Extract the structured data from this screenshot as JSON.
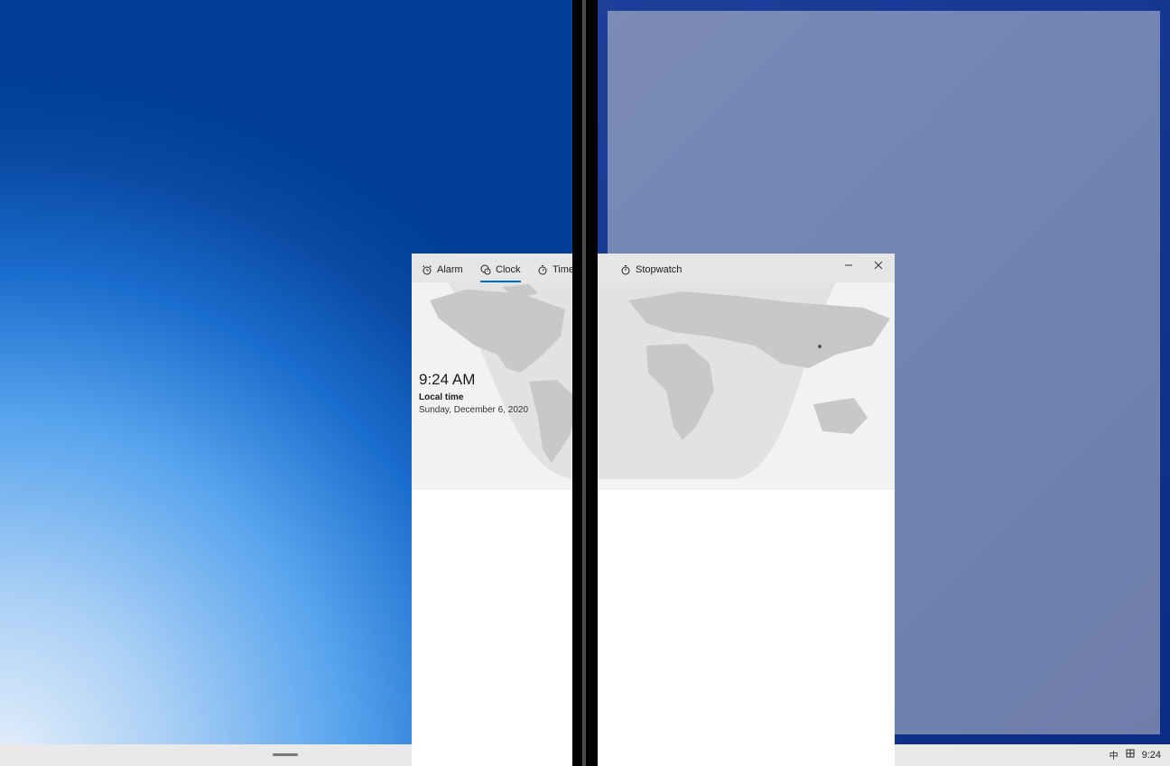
{
  "clock_app": {
    "tabs": [
      {
        "label": "Alarm",
        "icon": "alarm-clock-icon"
      },
      {
        "label": "Clock",
        "icon": "world-clock-icon",
        "active": true
      },
      {
        "label": "Timer",
        "icon": "timer-icon"
      },
      {
        "label": "Stopwatch",
        "icon": "stopwatch-icon"
      }
    ],
    "time": "9:24 AM",
    "location_label": "Local time",
    "date": "Sunday, December 6, 2020",
    "accent_color": "#0067c0"
  },
  "taskbar": {
    "ime_mode": "中",
    "ime_icon": "keyboard-layout-icon",
    "clock": "9:24"
  }
}
